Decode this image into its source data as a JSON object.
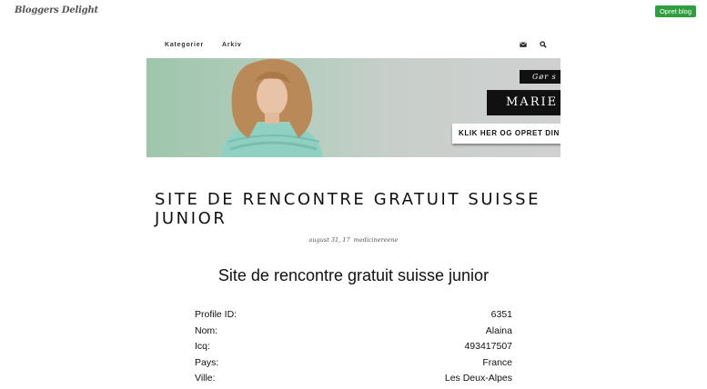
{
  "header": {
    "logo": "Bloggers Delight",
    "create_blog_label": "Opret blog"
  },
  "nav": {
    "items": [
      "Kategorier",
      "Arkiv"
    ],
    "icons": [
      "envelope-icon",
      "search-icon"
    ]
  },
  "banner": {
    "tagline": "Gør s",
    "name": "MARIE J",
    "cta": "KLIK HER OG OPRET DIN"
  },
  "post": {
    "title": "SITE DE RENCONTRE GRATUIT SUISSE JUNIOR",
    "date": "august 31, 17",
    "author": "medicinereene",
    "subtitle": "Site de rencontre gratuit suisse junior",
    "profile": [
      {
        "label": "Profile ID:",
        "value": "6351"
      },
      {
        "label": "Nom:",
        "value": "Alaina"
      },
      {
        "label": "Icq:",
        "value": "493417507"
      },
      {
        "label": "Pays:",
        "value": "France"
      },
      {
        "label": "Ville:",
        "value": "Les Deux-Alpes"
      }
    ]
  },
  "colors": {
    "create_button": "#2e9e3f",
    "banner_bg": "#b3cdbd"
  }
}
